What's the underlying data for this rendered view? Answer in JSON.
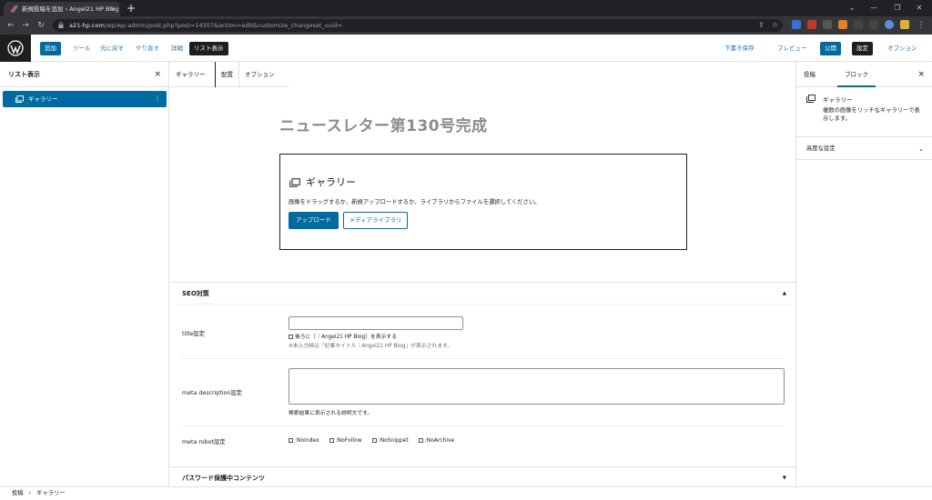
{
  "browser": {
    "tab_title": "新規投稿を追加 ‹ Angel21 HP Blog",
    "tab_close": "×",
    "new_tab": "+",
    "url_domain": "a21-hp.com",
    "url_path": "/wp/wp-admin/post.php?post=14357&action=edit&customize_changeset_uuid=",
    "win_min": "⌄",
    "win_minimize": "—",
    "win_restore": "❐",
    "win_close": "✕"
  },
  "toolbar": {
    "add": "追加",
    "tools": "ツール",
    "undo": "元に戻す",
    "redo": "やり直す",
    "details": "詳細",
    "list_view": "リスト表示",
    "save_draft": "下書き保存",
    "preview": "プレビュー",
    "publish": "公開",
    "settings": "設定",
    "options": "オプション"
  },
  "list_view": {
    "title": "リスト表示",
    "close": "×",
    "items": [
      {
        "label": "ギャラリー"
      }
    ],
    "item_menu": "⋮"
  },
  "block_toolbar": {
    "block_type": "ギャラリー",
    "align": "配置",
    "options": "オプション"
  },
  "editor": {
    "post_title": "ニュースレター第130号完成",
    "gallery": {
      "title": "ギャラリー",
      "instructions": "画像をドラッグするか、新規アップロードするか、ライブラリからファイルを選択してください。",
      "upload_button": "アップロード",
      "media_library_button": "メディアライブラリ"
    }
  },
  "seo": {
    "title": "SEO対策",
    "toggle": "▲",
    "title_setting": {
      "label": "title設定",
      "value": "",
      "append_checkbox": "後ろに［｜Angel21 HP Blog］を表示する",
      "note": "※未入力時は「記事タイトル｜Angel21 HP Blog」が表示されます。"
    },
    "meta_description": {
      "label": "meta description設定",
      "value": "",
      "help": "検索結果に表示される説明文です。"
    },
    "meta_robot": {
      "label": "meta robot設定",
      "options": [
        ":NoIndex",
        ":NoFollow",
        ":NoSnippet",
        ":NoArchive"
      ]
    }
  },
  "password_box": {
    "title": "パスワード保護中コンテンツ",
    "toggle": "▼"
  },
  "sidebar": {
    "tab_post": "投稿",
    "tab_block": "ブロック",
    "close": "×",
    "block_name": "ギャラリー",
    "block_description": "複数の画像をリッチなギャラリーで表示します。",
    "advanced": "高度な設定",
    "advanced_chevron": "⌄"
  },
  "breadcrumb": {
    "root": "投稿",
    "separator": "›",
    "current": "ギャラリー"
  },
  "colors": {
    "wp_blue": "#006ba1",
    "dark": "#1e1e1e",
    "chrome_bg": "#202124"
  }
}
